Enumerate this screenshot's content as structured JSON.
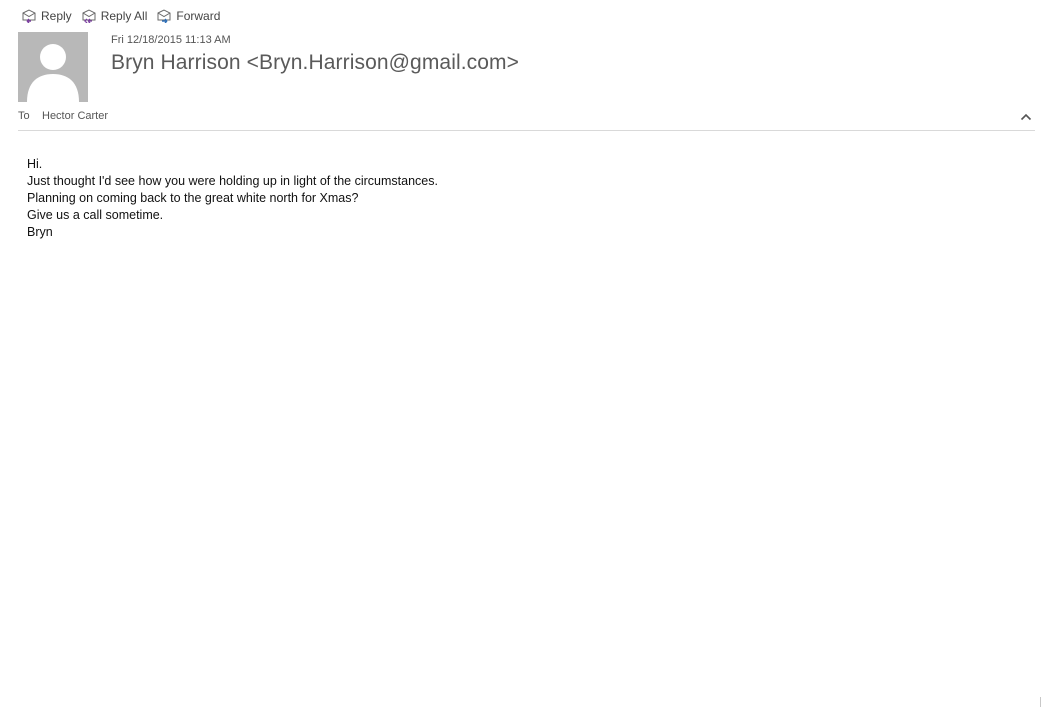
{
  "toolbar": {
    "reply_label": "Reply",
    "reply_all_label": "Reply All",
    "forward_label": "Forward"
  },
  "message": {
    "date": "Fri 12/18/2015 11:13 AM",
    "sender": "Bryn Harrison <Bryn.Harrison@gmail.com>",
    "to_label": "To",
    "to_value": "Hector Carter",
    "body_lines": [
      "Hi.",
      "Just thought I'd see how you were holding up in light of the circumstances.",
      "Planning on coming back to the great white north for Xmas?",
      "Give us a call sometime.",
      "Bryn"
    ]
  },
  "colors": {
    "accent_purple": "#7b3fa0",
    "accent_blue": "#2f6fb7",
    "avatar_bg": "#b8b8b8"
  }
}
